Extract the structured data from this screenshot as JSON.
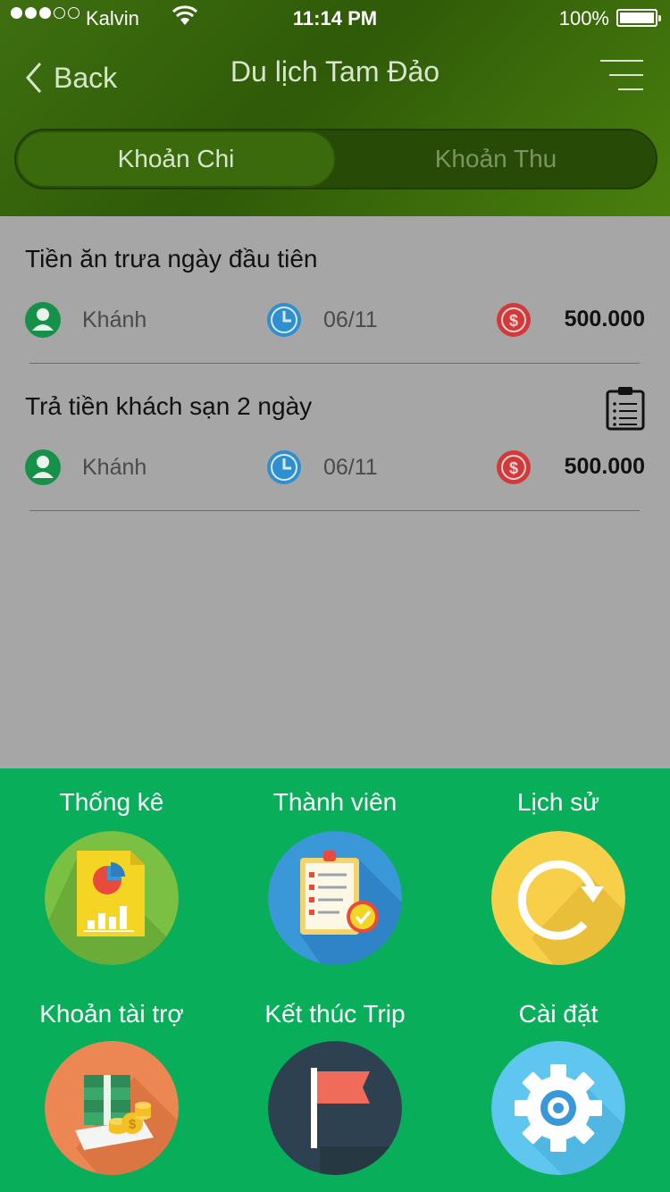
{
  "status_bar": {
    "carrier": "Kalvin",
    "time": "11:14 PM",
    "battery": "100%"
  },
  "nav": {
    "back_label": "Back",
    "title": "Du lịch Tam Đảo"
  },
  "tabs": [
    {
      "label": "Khoản Chi"
    },
    {
      "label": "Khoản Thu"
    }
  ],
  "expenses": [
    {
      "title": "Tiền ăn trưa ngày đầu tiên",
      "person": "Khánh",
      "date": "06/11",
      "amount": "500.000"
    },
    {
      "title": "Trả tiền khách sạn 2 ngày",
      "person": "Khánh",
      "date": "06/11",
      "amount": "500.000"
    }
  ],
  "menu": [
    {
      "label": "Thống kê",
      "icon": "statistics-icon",
      "color": "#7ac143"
    },
    {
      "label": "Thành viên",
      "icon": "members-checklist-icon",
      "color": "#3a98d8"
    },
    {
      "label": "Lịch sử",
      "icon": "history-refresh-icon",
      "color": "#f7cf48"
    },
    {
      "label": "Khoản tài trợ",
      "icon": "money-sponsor-icon",
      "color": "#ec8753"
    },
    {
      "label": "Kết thúc Trip",
      "icon": "finish-flag-icon",
      "color": "#2d4150"
    },
    {
      "label": "Cài đặt",
      "icon": "settings-gear-icon",
      "color": "#5fc7ef"
    }
  ],
  "colors": {
    "header": "#3e6f10",
    "menu_panel": "#09ae5a",
    "person_icon": "#16914a",
    "clock_icon": "#2f8fcf",
    "money_icon": "#d23a3a"
  }
}
